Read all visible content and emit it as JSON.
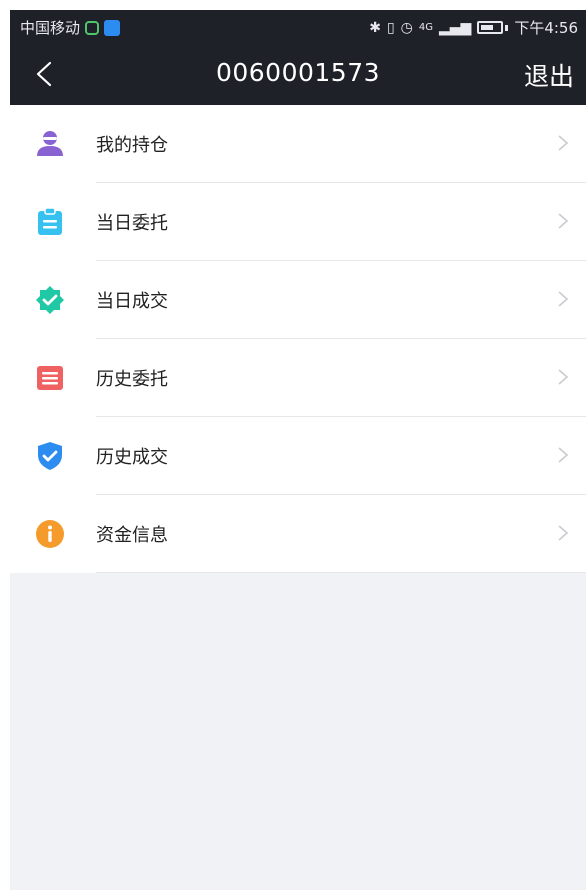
{
  "status_bar": {
    "carrier": "中国移动",
    "network": "4G",
    "time": "下午4:56"
  },
  "nav": {
    "title": "0060001573",
    "logout": "退出"
  },
  "menu": [
    {
      "label": "我的持仓",
      "icon": "user-icon",
      "color": "#8a63d2"
    },
    {
      "label": "当日委托",
      "icon": "clipboard-icon",
      "color": "#36c1f0"
    },
    {
      "label": "当日成交",
      "icon": "verified-badge-icon",
      "color": "#20c9a5"
    },
    {
      "label": "历史委托",
      "icon": "list-icon",
      "color": "#f06262"
    },
    {
      "label": "历史成交",
      "icon": "shield-check-icon",
      "color": "#2d8cf0"
    },
    {
      "label": "资金信息",
      "icon": "info-icon",
      "color": "#f59b2c"
    }
  ]
}
